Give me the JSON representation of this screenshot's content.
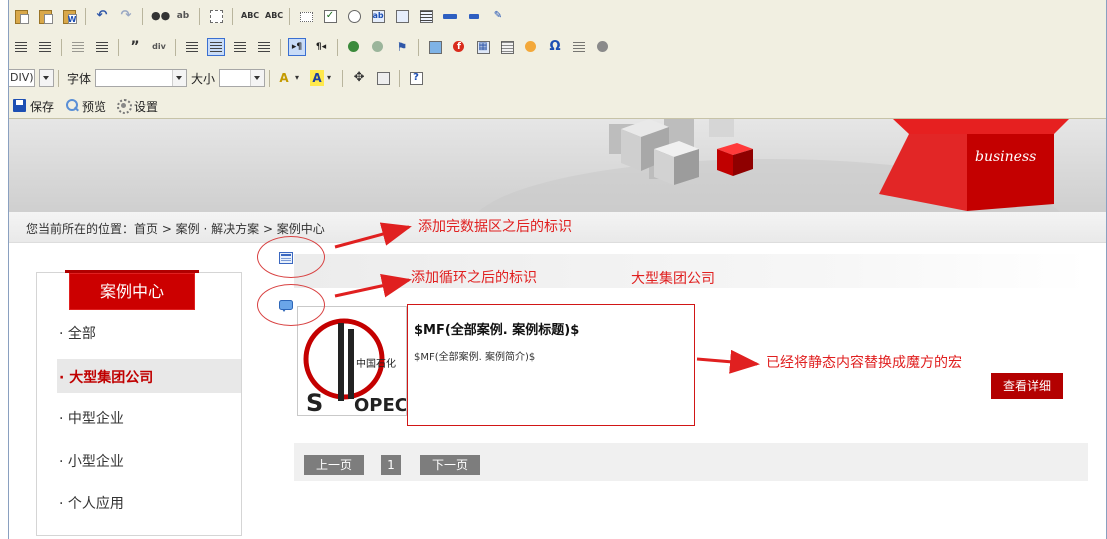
{
  "toolbar": {
    "row3": {
      "format_value": "DIV)",
      "font_label": "字体",
      "font_value": "",
      "size_label": "大小",
      "size_value": ""
    },
    "actions": [
      {
        "label": "保存",
        "icon": "save-icon"
      },
      {
        "label": "预览",
        "icon": "preview-icon"
      },
      {
        "label": "设置",
        "icon": "settings-icon"
      }
    ]
  },
  "banner": {
    "slogan": "business"
  },
  "breadcrumb": {
    "text": "您当前所在的位置：首页 > 案例 · 解决方案 > 案例中心"
  },
  "sidebar": {
    "title": "案例中心",
    "items": [
      {
        "label": "· 全部"
      },
      {
        "label": "· 大型集团公司",
        "active": true
      },
      {
        "label": "· 中型企业"
      },
      {
        "label": "· 小型企业"
      },
      {
        "label": "· 个人应用"
      }
    ]
  },
  "content": {
    "case_title": "$MF(全部案例. 案例标题)$",
    "case_intro": "$MF(全部案例. 案例简介)$",
    "detail_button": "查看详细",
    "pager": {
      "prev": "上一页",
      "page": "1",
      "next": "下一页"
    }
  },
  "annotations": {
    "data_area_mark": "添加完数据区之后的标识",
    "loop_mark": "添加循环之后的标识",
    "category_label": "大型集团公司",
    "macro_note": "已经将静态内容替换成魔方的宏"
  },
  "colors": {
    "accent_red": "#cc0000",
    "annotation_red": "#e02020",
    "toolbar_bg": "#f1efe1"
  }
}
